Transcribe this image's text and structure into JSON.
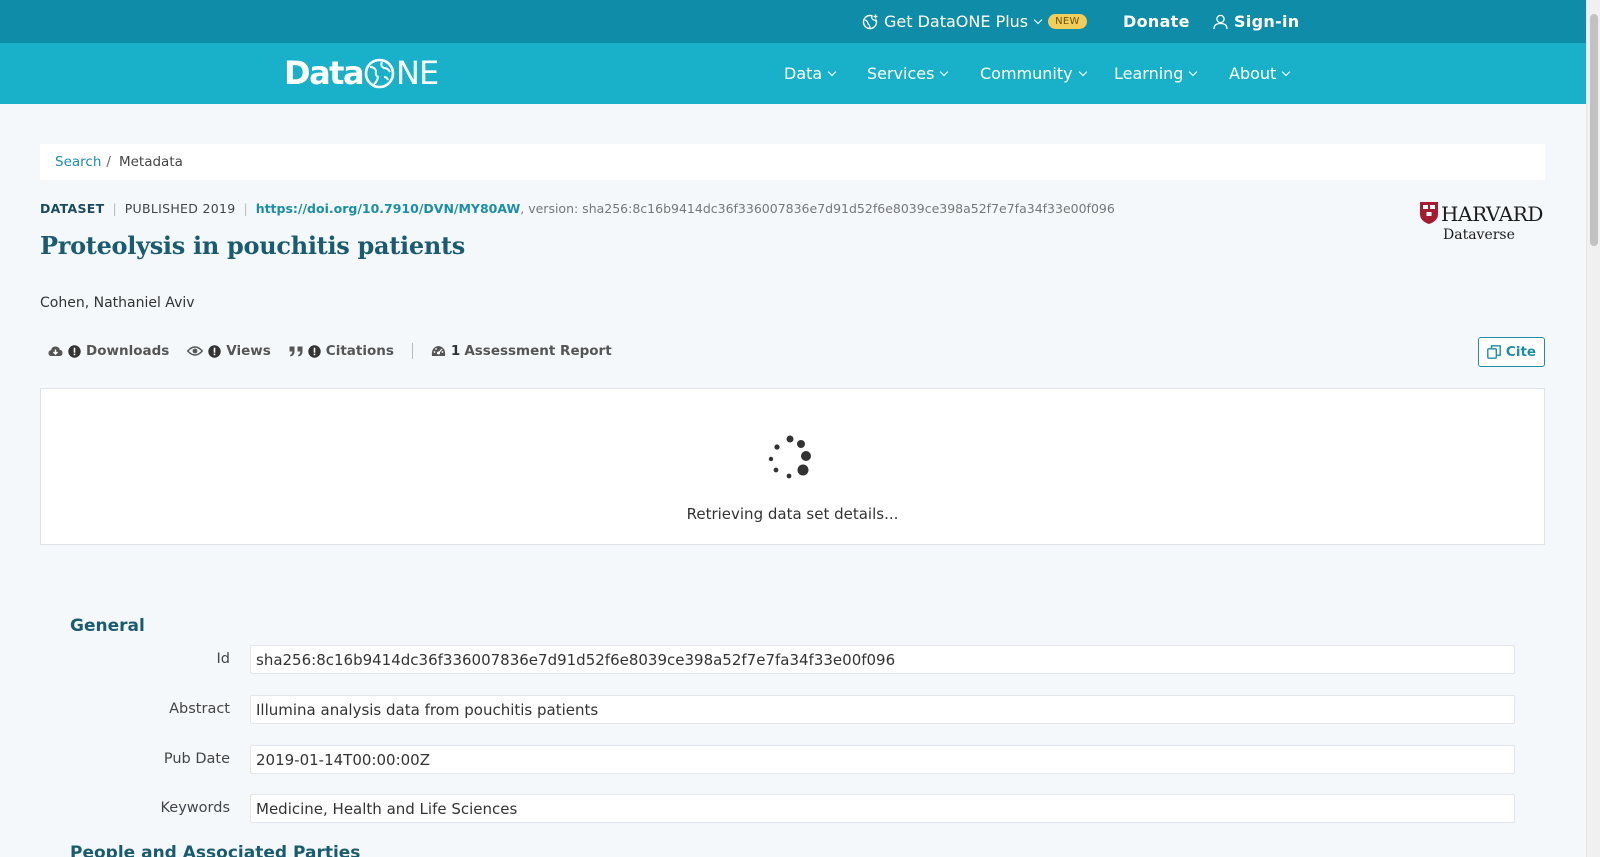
{
  "topbar": {
    "plus_label": "Get DataONE Plus",
    "new_badge": "NEW",
    "donate": "Donate",
    "signin": "Sign-in"
  },
  "logo": {
    "text_a": "Data",
    "text_b": "NE",
    "alt": "DataONE"
  },
  "nav": {
    "items": [
      "Data",
      "Services",
      "Community",
      "Learning",
      "About"
    ]
  },
  "breadcrumb": {
    "search": "Search",
    "separator": "/",
    "current": "Metadata"
  },
  "dataset": {
    "type": "DATASET",
    "published": "PUBLISHED 2019",
    "doi": "https://doi.org/10.7910/DVN/MY80AW",
    "version": ", version: sha256:8c16b9414dc36f336007836e7d91d52f6e8039ce398a52f7e7fa34f33e00f096",
    "title": "Proteolysis in pouchitis patients",
    "author": "Cohen, Nathaniel Aviv"
  },
  "repository": {
    "name": "HARVARD",
    "sub": "Dataverse"
  },
  "metrics": {
    "downloads": "Downloads",
    "views": "Views",
    "citations": "Citations",
    "assessment_count": "1",
    "assessment_label": "Assessment Report"
  },
  "cite_button": "Cite",
  "loading": {
    "text": "Retrieving data set details..."
  },
  "general": {
    "title": "General",
    "fields": [
      {
        "label": "Id",
        "value": "sha256:8c16b9414dc36f336007836e7d91d52f6e8039ce398a52f7e7fa34f33e00f096"
      },
      {
        "label": "Abstract",
        "value": "Illumina analysis data from pouchitis patients"
      },
      {
        "label": "Pub Date",
        "value": "2019-01-14T00:00:00Z"
      },
      {
        "label": "Keywords",
        "value": "Medicine, Health and Life Sciences"
      }
    ]
  },
  "people_section": {
    "title": "People and Associated Parties"
  },
  "colors": {
    "topbar": "#0f8ca8",
    "navbar": "#19b1c9",
    "accent": "#1c8ea6",
    "title": "#1b5b70",
    "badge": "#f3cd5a"
  },
  "icons": [
    "globe-plus-icon",
    "chevron-down-icon",
    "user-icon",
    "cloud-download-icon",
    "exclamation-circle-icon",
    "eye-icon",
    "quote-icon",
    "dashboard-icon",
    "copy-icon",
    "spinner-icon",
    "harvard-shield-icon"
  ]
}
